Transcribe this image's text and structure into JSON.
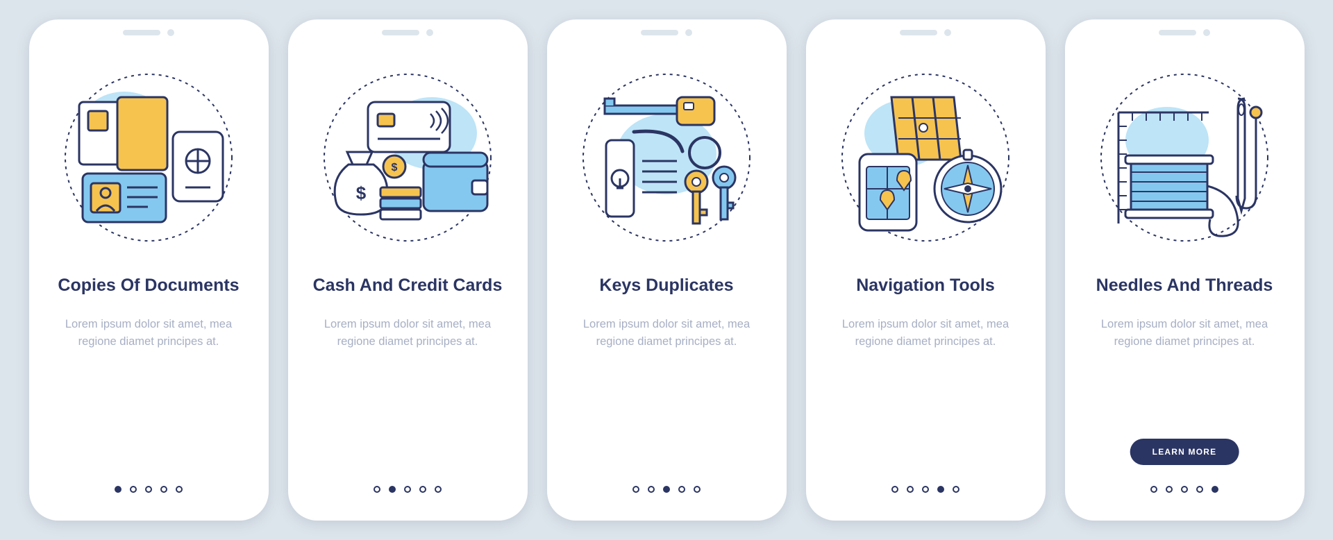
{
  "cards": [
    {
      "title": "Copies Of Documents",
      "desc": "Lorem ipsum dolor sit amet, mea regione diamet principes at.",
      "icon": "documents-icon",
      "active_dot": 0
    },
    {
      "title": "Cash And Credit Cards",
      "desc": "Lorem ipsum dolor sit amet, mea regione diamet principes at.",
      "icon": "cash-cards-icon",
      "active_dot": 1
    },
    {
      "title": "Keys Duplicates",
      "desc": "Lorem ipsum dolor sit amet, mea regione diamet principes at.",
      "icon": "keys-icon",
      "active_dot": 2
    },
    {
      "title": "Navigation Tools",
      "desc": "Lorem ipsum dolor sit amet, mea regione diamet principes at.",
      "icon": "navigation-icon",
      "active_dot": 3
    },
    {
      "title": "Needles And Threads",
      "desc": "Lorem ipsum dolor sit amet, mea regione diamet principes at.",
      "icon": "needle-thread-icon",
      "active_dot": 4
    }
  ],
  "learn_more_label": "LEARN MORE",
  "colors": {
    "dark": "#2b3563",
    "yellow": "#f6c34f",
    "lightblue": "#85c8ef",
    "bgblob": "#bde4f7"
  }
}
